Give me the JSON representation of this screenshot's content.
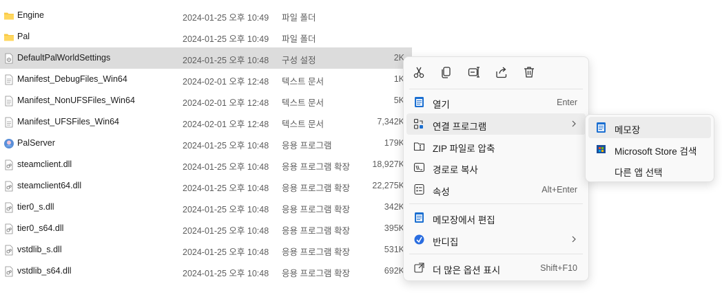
{
  "files": [
    {
      "icon": "folder-icon",
      "name": "Engine",
      "date": "2024-01-25 오후 10:49",
      "type": "파일 폴더",
      "size": ""
    },
    {
      "icon": "folder-icon",
      "name": "Pal",
      "date": "2024-01-25 오후 10:49",
      "type": "파일 폴더",
      "size": ""
    },
    {
      "icon": "settings-file-icon",
      "name": "DefaultPalWorldSettings",
      "date": "2024-01-25 오후 10:48",
      "type": "구성 설정",
      "size": "2K"
    },
    {
      "icon": "text-file-icon",
      "name": "Manifest_DebugFiles_Win64",
      "date": "2024-02-01 오후 12:48",
      "type": "텍스트 문서",
      "size": "1K"
    },
    {
      "icon": "text-file-icon",
      "name": "Manifest_NonUFSFiles_Win64",
      "date": "2024-02-01 오후 12:48",
      "type": "텍스트 문서",
      "size": "5K"
    },
    {
      "icon": "text-file-icon",
      "name": "Manifest_UFSFiles_Win64",
      "date": "2024-02-01 오후 12:48",
      "type": "텍스트 문서",
      "size": "7,342K"
    },
    {
      "icon": "app-icon",
      "name": "PalServer",
      "date": "2024-01-25 오후 10:48",
      "type": "응용 프로그램",
      "size": "179K"
    },
    {
      "icon": "dll-file-icon",
      "name": "steamclient.dll",
      "date": "2024-01-25 오후 10:48",
      "type": "응용 프로그램 확장",
      "size": "18,927K"
    },
    {
      "icon": "dll-file-icon",
      "name": "steamclient64.dll",
      "date": "2024-01-25 오후 10:48",
      "type": "응용 프로그램 확장",
      "size": "22,275K"
    },
    {
      "icon": "dll-file-icon",
      "name": "tier0_s.dll",
      "date": "2024-01-25 오후 10:48",
      "type": "응용 프로그램 확장",
      "size": "342K"
    },
    {
      "icon": "dll-file-icon",
      "name": "tier0_s64.dll",
      "date": "2024-01-25 오후 10:48",
      "type": "응용 프로그램 확장",
      "size": "395K"
    },
    {
      "icon": "dll-file-icon",
      "name": "vstdlib_s.dll",
      "date": "2024-01-25 오후 10:48",
      "type": "응용 프로그램 확장",
      "size": "531K"
    },
    {
      "icon": "dll-file-icon",
      "name": "vstdlib_s64.dll",
      "date": "2024-01-25 오후 10:48",
      "type": "응용 프로그램 확장",
      "size": "692K"
    }
  ],
  "context_menu": {
    "toolbar_icons": [
      "cut-icon",
      "copy-icon",
      "rename-icon",
      "share-icon",
      "delete-icon"
    ],
    "items": [
      {
        "label": "열기",
        "shortcut": "Enter",
        "icon": "notepad-icon"
      },
      {
        "label": "연결 프로그램",
        "shortcut": "",
        "icon": "open-with-icon",
        "submenu": true
      },
      {
        "label": "ZIP 파일로 압축",
        "shortcut": "",
        "icon": "zip-icon"
      },
      {
        "label": "경로로 복사",
        "shortcut": "",
        "icon": "copy-path-icon"
      },
      {
        "label": "속성",
        "shortcut": "Alt+Enter",
        "icon": "properties-icon"
      },
      {
        "label": "메모장에서 편집",
        "shortcut": "",
        "icon": "notepad-edit-icon"
      },
      {
        "label": "반디집",
        "shortcut": "",
        "icon": "bandizip-icon",
        "submenu": true
      },
      {
        "label": "더 많은 옵션 표시",
        "shortcut": "Shift+F10",
        "icon": "more-options-icon"
      }
    ]
  },
  "submenu": {
    "items": [
      {
        "label": "메모장",
        "icon": "notepad-icon"
      },
      {
        "label": "Microsoft Store 검색",
        "icon": "store-icon"
      },
      {
        "label": "다른 앱 선택",
        "icon": ""
      }
    ]
  },
  "colors": {
    "selection": "#dcdcdc",
    "folder": "#f8c844",
    "accent": "#1e6fd9"
  }
}
